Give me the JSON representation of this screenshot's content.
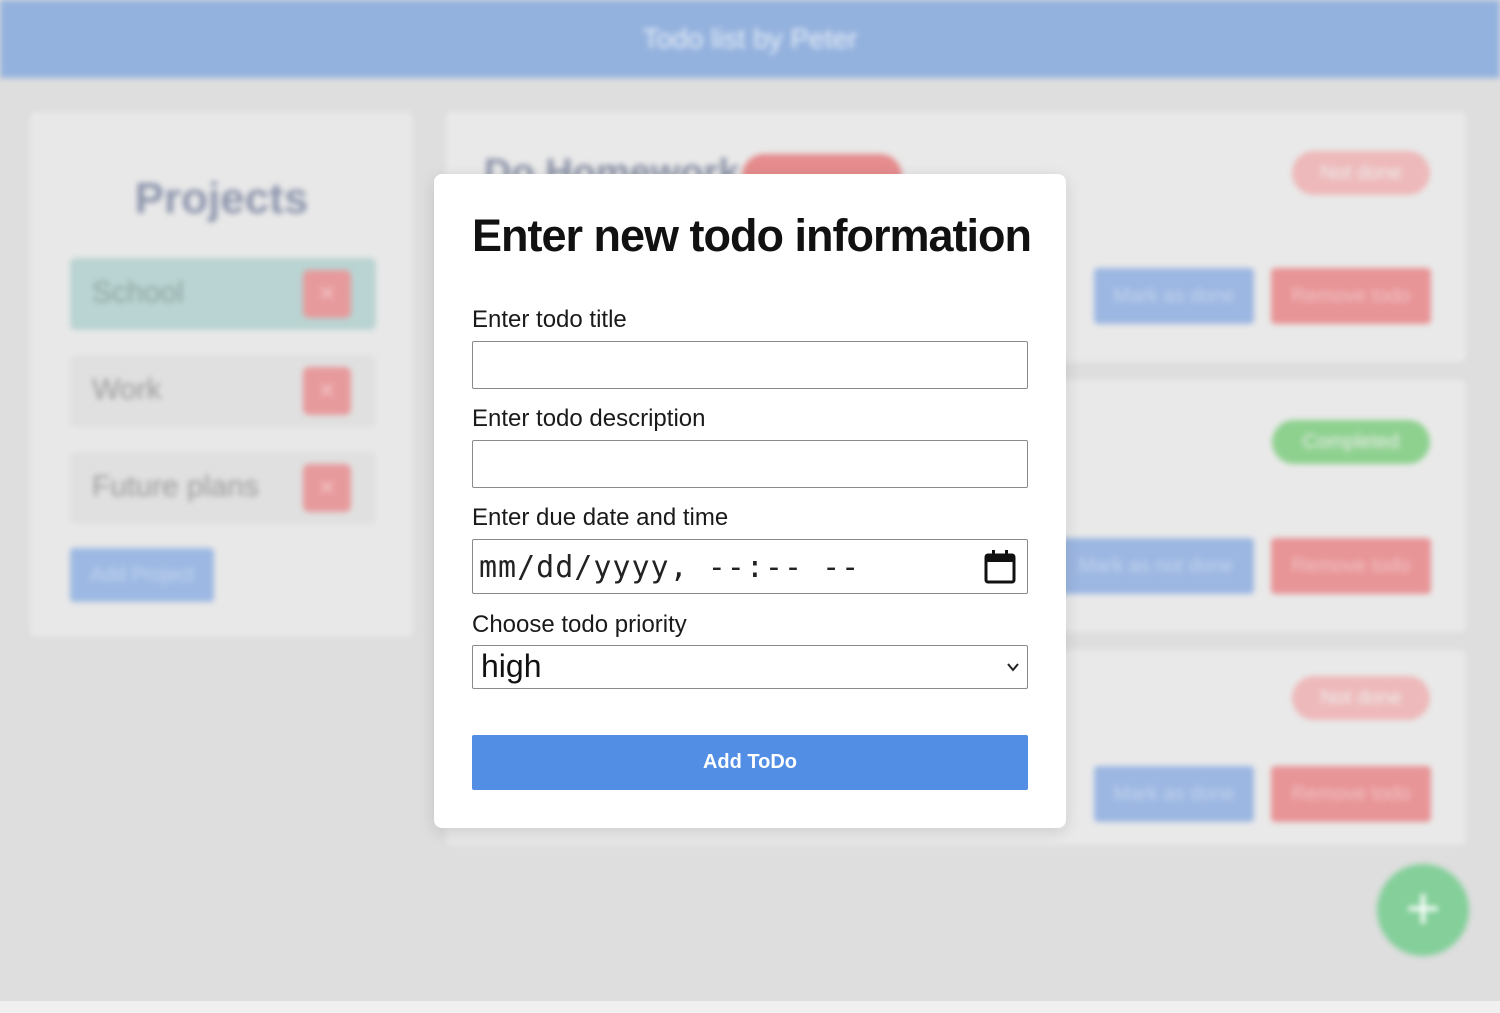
{
  "app": {
    "title": "Todo list by Peter"
  },
  "sidebar": {
    "title": "Projects",
    "projects": [
      {
        "label": "School",
        "active": true
      },
      {
        "label": "Work",
        "active": false
      },
      {
        "label": "Future plans",
        "active": false
      }
    ],
    "add_project_label": "Add Project"
  },
  "todos": [
    {
      "title": "Do Homework",
      "status": "Not done",
      "primary_action": "Mark as done",
      "remove_action": "Remove todo"
    },
    {
      "title": "",
      "status": "Completed",
      "primary_action": "Mark as not done",
      "remove_action": "Remove todo"
    },
    {
      "title": "",
      "status": "Not done",
      "primary_action": "Mark as done",
      "remove_action": "Remove todo"
    }
  ],
  "fab": {
    "icon": "plus-icon",
    "glyph": "+"
  },
  "modal": {
    "title": "Enter new todo information",
    "fields": {
      "title_label": "Enter todo title",
      "title_value": "",
      "description_label": "Enter todo description",
      "description_value": "",
      "due_label": "Enter due date and time",
      "due_placeholder": "mm/dd/yyyy, --:-- --",
      "priority_label": "Choose todo priority",
      "priority_value": "high"
    },
    "submit_label": "Add ToDo"
  },
  "colors": {
    "header": "#94b2de",
    "submit_button": "#528ee4",
    "fab": "#84cf9a",
    "status_done": "#8ed18f",
    "status_not_done": "#eeb9ba",
    "remove_button": "#e89597"
  }
}
